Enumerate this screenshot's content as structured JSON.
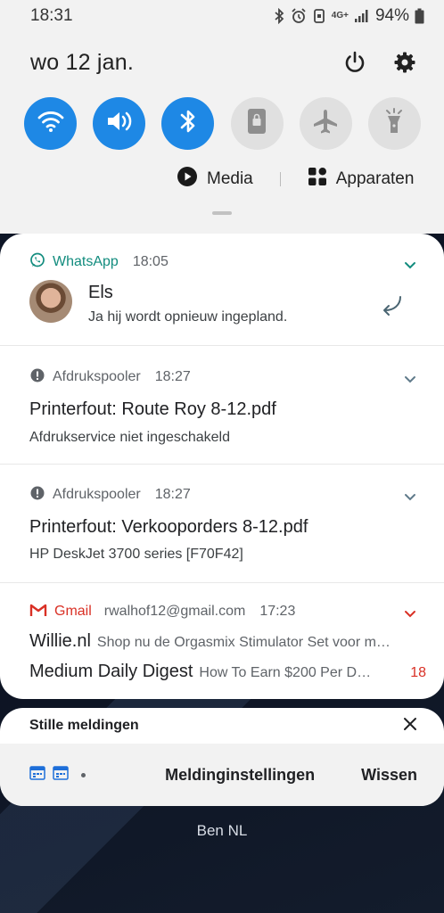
{
  "status_bar": {
    "time": "18:31",
    "network": "4G+",
    "battery": "94%"
  },
  "header": {
    "date": "wo 12 jan."
  },
  "quick_toggles": [
    {
      "name": "wifi",
      "state": "on"
    },
    {
      "name": "sound",
      "state": "on"
    },
    {
      "name": "bluetooth",
      "state": "on"
    },
    {
      "name": "screen-lock",
      "state": "off"
    },
    {
      "name": "airplane",
      "state": "off"
    },
    {
      "name": "flashlight",
      "state": "off"
    }
  ],
  "media_row": {
    "media_label": "Media",
    "devices_label": "Apparaten"
  },
  "notifications": {
    "whatsapp": {
      "app": "WhatsApp",
      "time": "18:05",
      "sender": "Els",
      "message": "Ja hij wordt opnieuw ingepland."
    },
    "printer1": {
      "app": "Afdrukspooler",
      "time": "18:27",
      "title": "Printerfout: Route Roy 8-12.pdf",
      "text": "Afdrukservice niet ingeschakeld"
    },
    "printer2": {
      "app": "Afdrukspooler",
      "time": "18:27",
      "title": "Printerfout: Verkooporders 8-12.pdf",
      "text": "HP DeskJet 3700 series [F70F42]"
    },
    "gmail": {
      "app": "Gmail",
      "account": "rwalhof12@gmail.com",
      "time": "17:23",
      "messages": [
        {
          "sender": "Willie.nl",
          "subject": "Shop nu de Orgasmix Stimulator Set voor m…"
        },
        {
          "sender": "Medium Daily Digest",
          "subject": "How To Earn $200 Per D…",
          "count": "18"
        }
      ]
    }
  },
  "silent": {
    "title": "Stille meldingen",
    "settings_label": "Meldinginstellingen",
    "clear_label": "Wissen"
  },
  "carrier": "Ben NL",
  "colors": {
    "accent": "#1e88e5",
    "whatsapp": "#128c7e",
    "gmail": "#d93025",
    "panel_bg": "#f2f2f2"
  }
}
